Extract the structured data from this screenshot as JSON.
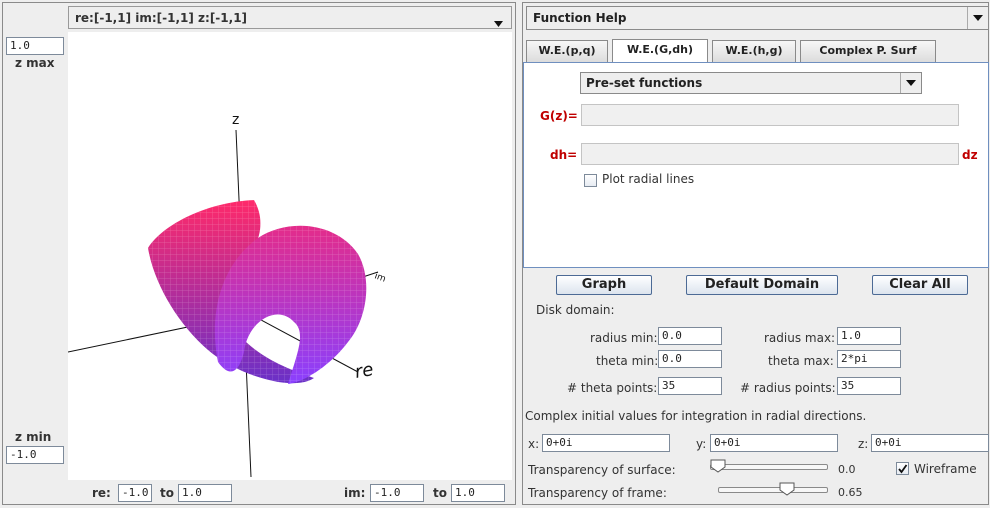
{
  "plot": {
    "domain_select": "re:[-1,1] im:[-1,1] z:[-1,1]",
    "z_max_value": "1.0",
    "z_max_label": "z max",
    "z_min_label": "z min",
    "z_min_value": "-1.0",
    "axis_z": "z",
    "axis_im": "im",
    "axis_re": "re",
    "re_label": "re:",
    "re_from": "-1.0",
    "re_to_label": "to",
    "re_to": "1.0",
    "im_label": "im:",
    "im_from": "-1.0",
    "im_to_label": "to",
    "im_to": "1.0"
  },
  "help": {
    "select": "Function Help"
  },
  "tabs": [
    {
      "label": "W.E.(p,q)"
    },
    {
      "label": "W.E.(G,dh)"
    },
    {
      "label": "W.E.(h,g)"
    },
    {
      "label": "Complex P. Surf"
    }
  ],
  "tab_panel": {
    "preset": "Pre-set functions",
    "g_label": "G(z)=",
    "g_value": "",
    "dh_label": "dh=",
    "dh_value": "",
    "dz_label": "dz",
    "radial_label": "Plot radial lines"
  },
  "buttons": {
    "graph": "Graph",
    "default_domain": "Default Domain",
    "clear_all": "Clear All"
  },
  "disk": {
    "title": "Disk domain:",
    "radius_min_label": "radius min:",
    "radius_min": "0.0",
    "radius_max_label": "radius max:",
    "radius_max": "1.0",
    "theta_min_label": "theta min:",
    "theta_min": "0.0",
    "theta_max_label": "theta max:",
    "theta_max": "2*pi",
    "theta_points_label": "# theta points:",
    "theta_points": "35",
    "radius_points_label": "# radius points:",
    "radius_points": "35"
  },
  "initial": {
    "title": "Complex initial values for integration in radial directions.",
    "x_label": "x:",
    "x_value": "0+0i",
    "y_label": "y:",
    "y_value": "0+0i",
    "z_label": "z:",
    "z_value": "0+0i"
  },
  "transparency": {
    "surface_label": "Transparency of surface:",
    "surface_value": "0.0",
    "surface_fraction": 0.0,
    "frame_label": "Transparency of frame:",
    "frame_value": "0.65",
    "frame_fraction": 0.65,
    "wireframe_label": "Wireframe",
    "wireframe_checked": true
  },
  "colors": {
    "surface_top": "#ff2a6a",
    "surface_bottom": "#7a3cff",
    "label_red": "#c00000"
  }
}
